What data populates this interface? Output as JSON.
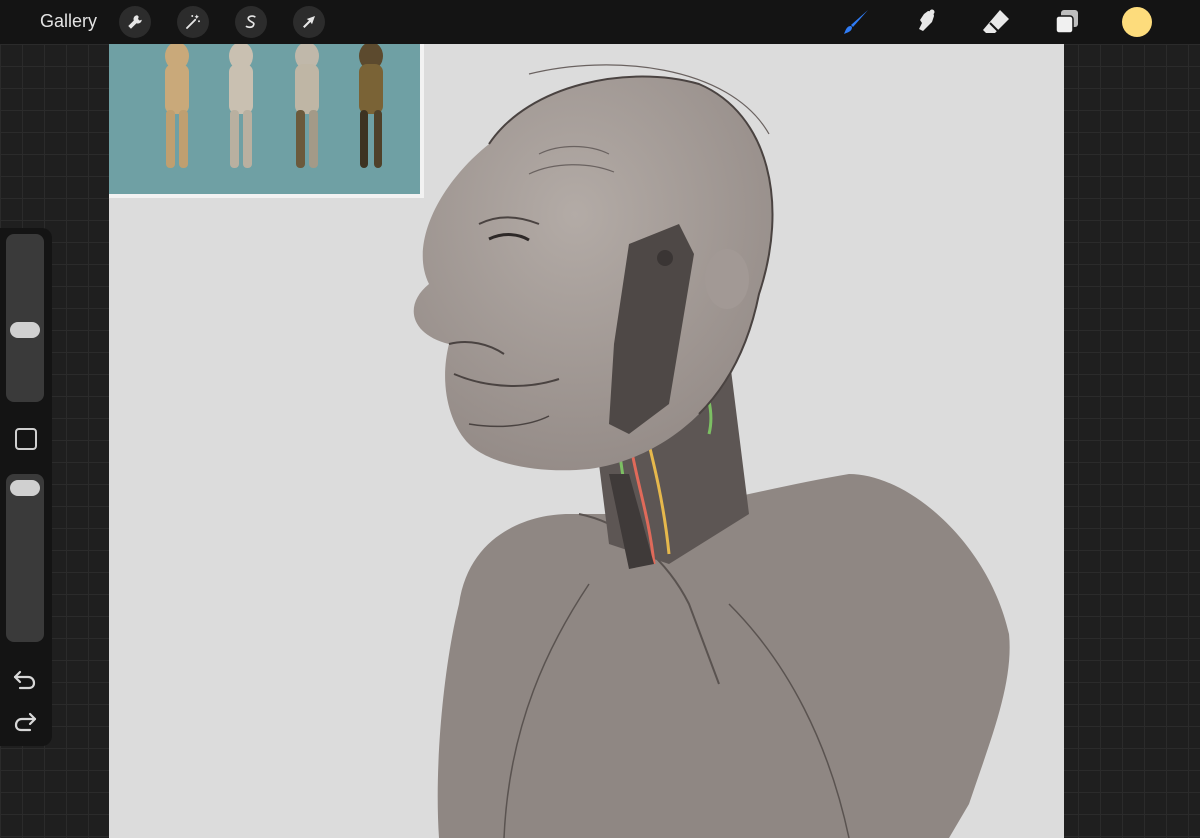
{
  "topbar": {
    "gallery_label": "Gallery",
    "left_tools": [
      "wrench-icon",
      "magic-wand-icon",
      "selection-icon",
      "transform-arrow-icon"
    ],
    "right_tools": [
      "brush-icon",
      "smudge-icon",
      "eraser-icon",
      "layers-icon"
    ],
    "active_tool": "brush",
    "active_color": "#fddc7c",
    "accent_color": "#2f7cf6"
  },
  "sidebar": {
    "controls": [
      "brush-size-slider",
      "modify-button",
      "opacity-slider",
      "undo-icon",
      "redo-icon"
    ]
  },
  "canvas": {
    "background_color": "#dcdcdc",
    "reference_image_background": "#6fa0a4"
  }
}
